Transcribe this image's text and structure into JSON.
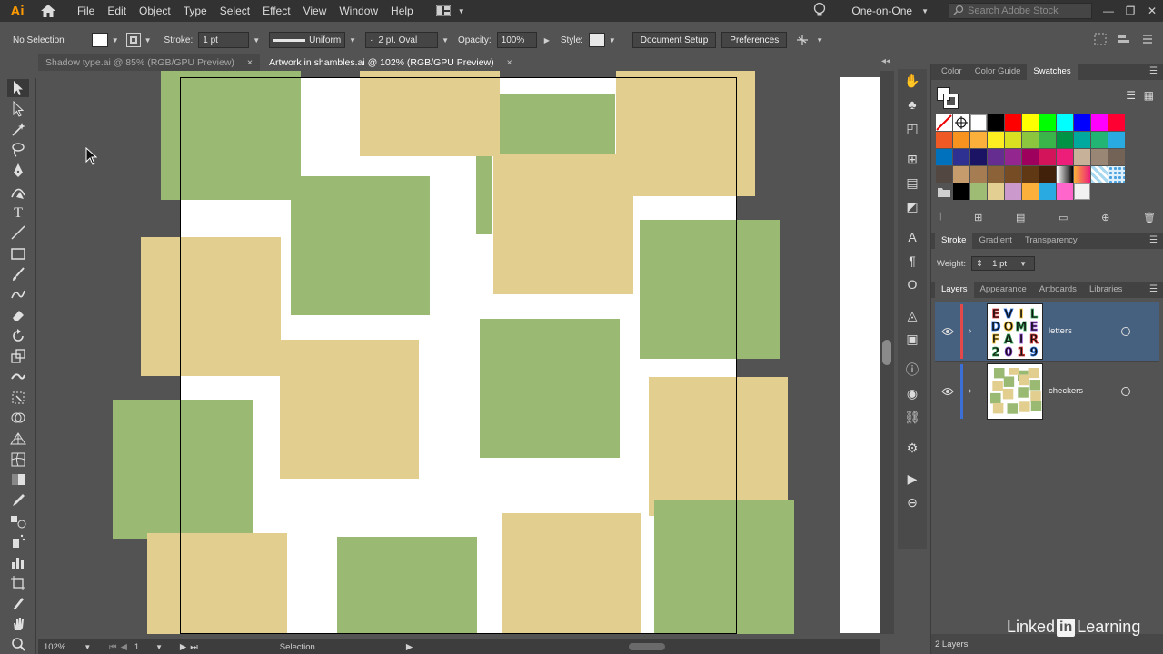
{
  "app": {
    "logo": "Ai",
    "menu": [
      "File",
      "Edit",
      "Object",
      "Type",
      "Select",
      "Effect",
      "View",
      "Window",
      "Help"
    ],
    "workspace": "One-on-One",
    "search_placeholder": "Search Adobe Stock"
  },
  "control_bar": {
    "selection": "No Selection",
    "stroke_label": "Stroke:",
    "stroke_value": "1 pt",
    "profile": "Uniform",
    "brush": "2 pt. Oval",
    "opacity_label": "Opacity:",
    "opacity_value": "100%",
    "style_label": "Style:",
    "document_setup": "Document Setup",
    "preferences": "Preferences"
  },
  "doc_tabs": [
    {
      "label": "Shadow type.ai @ 85% (RGB/GPU Preview)",
      "close": "×",
      "active": false
    },
    {
      "label": "Artwork in shambles.ai @ 102% (RGB/GPU Preview)",
      "close": "×",
      "active": true
    }
  ],
  "tools": [
    "selection-tool",
    "direct-selection-tool",
    "magic-wand-tool",
    "lasso-tool",
    "pen-tool",
    "curvature-tool",
    "type-tool",
    "line-tool",
    "rectangle-tool",
    "paintbrush-tool",
    "shaper-tool",
    "eraser-tool",
    "rotate-tool",
    "scale-tool",
    "warp-tool",
    "free-transform-tool",
    "shape-builder-tool",
    "perspective-grid-tool",
    "mesh-tool",
    "gradient-tool",
    "eyedropper-tool",
    "blend-tool",
    "symbol-sprayer-tool",
    "column-graph-tool",
    "artboard-tool",
    "slice-tool",
    "hand-tool",
    "zoom-tool"
  ],
  "status_bar": {
    "zoom": "102%",
    "artboard": "1",
    "tool_name": "Selection"
  },
  "panels": {
    "color_tabs": [
      "Color",
      "Color Guide",
      "Swatches"
    ],
    "stroke_tabs": [
      "Stroke",
      "Gradient",
      "Transparency"
    ],
    "weight_label": "Weight:",
    "weight_value": "1 pt",
    "layer_tabs": [
      "Layers",
      "Appearance",
      "Artboards",
      "Libraries"
    ],
    "layers": [
      {
        "name": "letters",
        "color": "#e2484a",
        "selected": true
      },
      {
        "name": "checkers",
        "color": "#3b6fd6",
        "selected": false
      }
    ],
    "layers_count": "2 Layers"
  },
  "thumb_letters": {
    "rows": [
      "EVIL",
      "DOME",
      "FAIR",
      "2019"
    ]
  },
  "swatch_colors": [
    [
      "none",
      "registration",
      "#ffffff",
      "#000000",
      "#ff0000",
      "#ffff00",
      "#00ff00",
      "#00ffff",
      "#0000ff",
      "#ff00ff",
      "#ff0033"
    ],
    [
      "#ef5a24",
      "#f7931e",
      "#fbb03b",
      "#fcee21",
      "#d9e021",
      "#8cc63f",
      "#39b54a",
      "#009245",
      "#00a99d",
      "#22b573",
      "#29abe2"
    ],
    [
      "#0071bc",
      "#2e3192",
      "#1b1464",
      "#662d91",
      "#93278f",
      "#9e005d",
      "#d4145a",
      "#ed1e79",
      "#c7b299",
      "#998675",
      "#736357"
    ],
    [
      "#534741",
      "#c69c6d",
      "#a67c52",
      "#8c6239",
      "#754c24",
      "#603813",
      "#42210b",
      "gradient-bw",
      "gradient-color",
      "pattern-blue",
      "pattern-dots"
    ],
    [
      "folder",
      "#000000",
      "#9ebc74",
      "#e3cf91",
      "#cc99cc",
      "#fbb03b",
      "#29abe2",
      "#ff66cc",
      "#f2f2f2"
    ]
  ],
  "colors": {
    "green": "#9aba73",
    "tan": "#e2cf90",
    "artboard": "#ffffff",
    "ui_bg": "#535353",
    "menubar": "#323232",
    "highlight": "#46607f"
  },
  "watermark": {
    "left": "Linked",
    "box": "in",
    "right": " Learning"
  }
}
